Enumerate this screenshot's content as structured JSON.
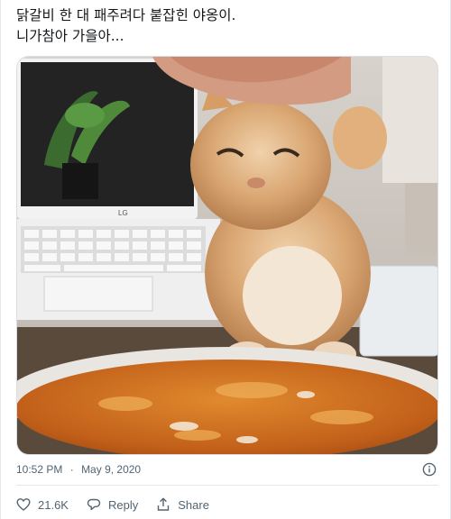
{
  "tweet": {
    "text": "닭갈비 한 대 패주려다 붙잡힌 야옹이.\n니가참아 가을아...",
    "time": "10:52 PM",
    "separator": "·",
    "date": "May 9, 2020"
  },
  "photo": {
    "laptop_brand": "LG",
    "icon": "cat-photo"
  },
  "actions": {
    "like_count": "21.6K",
    "reply_label": "Reply",
    "share_label": "Share"
  },
  "icons": {
    "like": "heart-icon",
    "reply": "speech-bubble-icon",
    "share": "share-icon",
    "info": "info-icon"
  },
  "colors": {
    "text": "#14171a",
    "secondary": "#536471",
    "border": "#e1e8ed"
  }
}
